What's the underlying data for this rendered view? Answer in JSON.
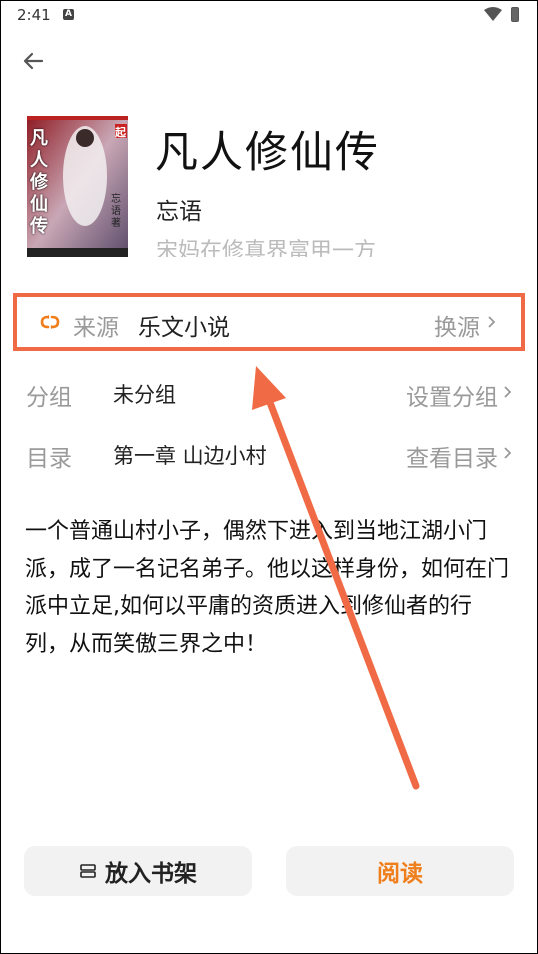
{
  "status_bar": {
    "time": "2:41",
    "app_badge": "A"
  },
  "book": {
    "title": "凡人修仙传",
    "author": "忘语",
    "intro_preview": "宋妈在修真界富甲一方",
    "cover_text": "凡人修仙传",
    "cover_badge": "起",
    "cover_author": "忘语著"
  },
  "info_rows": {
    "source": {
      "label": "来源",
      "value": "乐文小说",
      "action": "换源"
    },
    "group": {
      "label": "分组",
      "value": "未分组",
      "action": "设置分组"
    },
    "catalog": {
      "label": "目录",
      "value": "第一章 山边小村",
      "action": "查看目录"
    }
  },
  "description": "一个普通山村小子，偶然下进入到当地江湖小门派，成了一名记名弟子。他以这样身份，如何在门派中立足,如何以平庸的资质进入到修仙者的行列，从而笑傲三界之中！",
  "buttons": {
    "add_shelf": "放入书架",
    "read": "阅读"
  },
  "colors": {
    "accent": "#f07e1b",
    "highlight": "#f06b45",
    "muted": "#9a9a9a"
  },
  "icons": [
    "back-arrow-icon",
    "wifi-icon",
    "battery-icon",
    "refresh-icon",
    "chevron-right-icon",
    "bookshelf-icon"
  ]
}
